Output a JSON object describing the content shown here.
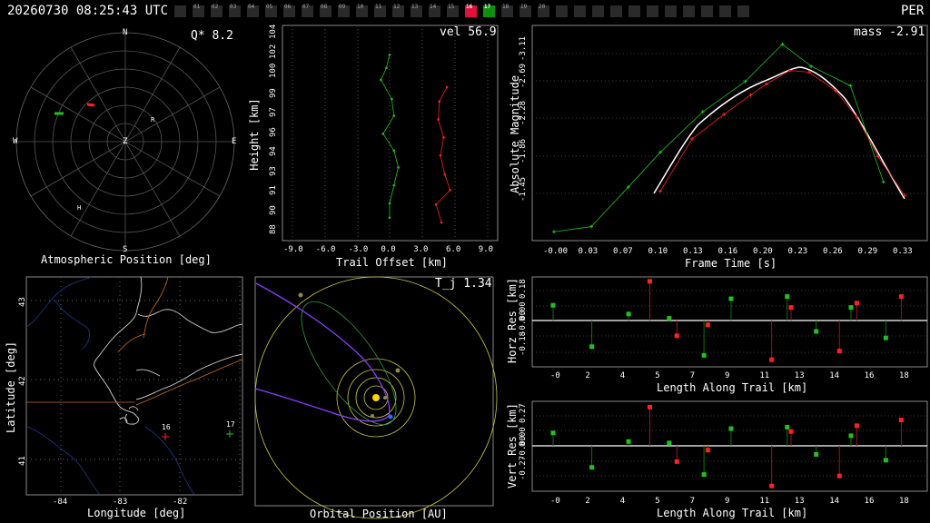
{
  "header": {
    "datetime": "20260730 08:25:43 UTC",
    "shower": "PER",
    "cameras": [
      {
        "id": "",
        "state": "off"
      },
      {
        "id": "01",
        "state": "off"
      },
      {
        "id": "02",
        "state": "off"
      },
      {
        "id": "03",
        "state": "off"
      },
      {
        "id": "04",
        "state": "off"
      },
      {
        "id": "05",
        "state": "off"
      },
      {
        "id": "06",
        "state": "off"
      },
      {
        "id": "07",
        "state": "off"
      },
      {
        "id": "08",
        "state": "off"
      },
      {
        "id": "09",
        "state": "off"
      },
      {
        "id": "10",
        "state": "off"
      },
      {
        "id": "11",
        "state": "off"
      },
      {
        "id": "12",
        "state": "off"
      },
      {
        "id": "13",
        "state": "off"
      },
      {
        "id": "14",
        "state": "off"
      },
      {
        "id": "15",
        "state": "off"
      },
      {
        "id": "16",
        "state": "red"
      },
      {
        "id": "17",
        "state": "green"
      },
      {
        "id": "18",
        "state": "off"
      },
      {
        "id": "19",
        "state": "off"
      },
      {
        "id": "20",
        "state": "off"
      },
      {
        "id": "",
        "state": "off"
      },
      {
        "id": "",
        "state": "off"
      },
      {
        "id": "",
        "state": "off"
      },
      {
        "id": "",
        "state": "off"
      },
      {
        "id": "",
        "state": "off"
      },
      {
        "id": "",
        "state": "off"
      },
      {
        "id": "",
        "state": "off"
      },
      {
        "id": "",
        "state": "off"
      },
      {
        "id": "",
        "state": "off"
      },
      {
        "id": "",
        "state": "off"
      },
      {
        "id": "",
        "state": "off"
      }
    ]
  },
  "colors": {
    "cam_red": "#e0123c",
    "cam_green": "#109010",
    "cam_off": "#2a2a2a",
    "series_red": "#ff2020",
    "series_green": "#20c020",
    "axis": "#ffffff"
  },
  "panels": {
    "atmo": {
      "caption": "Atmospheric Position [deg]",
      "metric": "Q*  8.2",
      "compass": {
        "N": "N",
        "S": "S",
        "E": "E",
        "W": "W",
        "Z": "Z"
      },
      "markers": {
        "radiant": "R",
        "h": "H"
      }
    },
    "height": {
      "metric": "vel 56.9",
      "xlabel": "Trail Offset [km]",
      "ylabel": "Height [km]",
      "xticks": [
        "-9.0",
        "-6.0",
        "-3.0",
        "0.0",
        "3.0",
        "6.0",
        "9.0"
      ],
      "yticks": [
        "88",
        "90",
        "91",
        "93",
        "94",
        "96",
        "97",
        "99",
        "100",
        "102",
        "104"
      ]
    },
    "magnitude": {
      "metric": "mass -2.91",
      "xlabel": "Frame Time [s]",
      "ylabel": "Absolute Magnitude",
      "xticks": [
        "-0.00",
        "0.03",
        "0.07",
        "0.10",
        "0.13",
        "0.16",
        "0.20",
        "0.23",
        "0.26",
        "0.29",
        "0.33"
      ],
      "yticks": [
        "-3.11",
        "-2.69",
        "-2.28",
        "-1.86",
        "-1.45"
      ]
    },
    "map": {
      "xlabel": "Longitude [deg]",
      "ylabel": "Latitude [deg]",
      "xticks": [
        "-84",
        "-83",
        "-82"
      ],
      "yticks": [
        "43",
        "42",
        "41"
      ],
      "stations": [
        {
          "label": "16"
        },
        {
          "label": "17"
        }
      ]
    },
    "orbit": {
      "caption": "Orbital Position [AU]",
      "metric": "T_j 1.34"
    },
    "horz": {
      "xlabel": "Length Along Trail [km]",
      "ylabel": "Horz Res [km]",
      "xticks": [
        "-0",
        "2",
        "4",
        "5",
        "7",
        "9",
        "11",
        "13",
        "14",
        "16",
        "18"
      ],
      "yticks": [
        "0.18",
        "0.00",
        "-0.00",
        "-0.18"
      ]
    },
    "vert": {
      "xlabel": "Length Along Trail [km]",
      "ylabel": "Vert Res [km]",
      "xticks": [
        "-0",
        "2",
        "4",
        "5",
        "7",
        "9",
        "11",
        "13",
        "14",
        "16",
        "18"
      ],
      "yticks": [
        "0.27",
        "0.00",
        "-0.00",
        "-0.27"
      ]
    }
  },
  "chart_data": [
    {
      "type": "line",
      "name": "height",
      "xlim": [
        -10.5,
        10.5
      ],
      "series": [
        {
          "color": "green",
          "points": [
            [
              0,
              102.3
            ],
            [
              -0.3,
              101.2
            ],
            [
              -0.8,
              100.2
            ],
            [
              0.2,
              98.6
            ],
            [
              0.4,
              97.2
            ],
            [
              -0.6,
              95.7
            ],
            [
              0.4,
              94.3
            ],
            [
              0.8,
              92.9
            ],
            [
              0.4,
              91.4
            ],
            [
              0.0,
              89.9
            ],
            [
              0.0,
              88.7
            ]
          ]
        },
        {
          "color": "red",
          "points": [
            [
              5.3,
              99.6
            ],
            [
              4.6,
              98.4
            ],
            [
              4.5,
              96.9
            ],
            [
              5.0,
              95.4
            ],
            [
              4.7,
              93.9
            ],
            [
              5.1,
              92.3
            ],
            [
              5.6,
              91.0
            ],
            [
              4.3,
              89.8
            ],
            [
              4.8,
              88.3
            ]
          ]
        }
      ]
    },
    {
      "type": "line",
      "name": "magnitude",
      "xlim": [
        -0.01,
        0.34
      ],
      "series": [
        {
          "color": "green",
          "points": [
            [
              0.0,
              -1.0
            ],
            [
              0.035,
              -1.06
            ],
            [
              0.07,
              -1.53
            ],
            [
              0.1,
              -1.94
            ],
            [
              0.14,
              -2.42
            ],
            [
              0.18,
              -2.78
            ],
            [
              0.215,
              -3.22
            ],
            [
              0.242,
              -2.96
            ],
            [
              0.279,
              -2.73
            ],
            [
              0.31,
              -1.59
            ]
          ]
        },
        {
          "color": "red",
          "points": [
            [
              0.1,
              -1.48
            ],
            [
              0.13,
              -2.1
            ],
            [
              0.16,
              -2.39
            ],
            [
              0.185,
              -2.62
            ],
            [
              0.2,
              -2.75
            ],
            [
              0.222,
              -2.91
            ],
            [
              0.24,
              -2.89
            ],
            [
              0.265,
              -2.67
            ],
            [
              0.285,
              -2.36
            ],
            [
              0.305,
              -1.89
            ],
            [
              0.33,
              -1.43
            ]
          ]
        }
      ]
    },
    {
      "type": "scatter",
      "name": "horz_res",
      "series": [
        {
          "color": "green",
          "points": [
            [
              0.0,
              0.07
            ],
            [
              2.0,
              -0.12
            ],
            [
              3.9,
              0.03
            ],
            [
              6.0,
              0.01
            ],
            [
              7.8,
              -0.16
            ],
            [
              9.2,
              0.1
            ],
            [
              12.1,
              0.11
            ],
            [
              13.6,
              -0.05
            ],
            [
              15.4,
              0.06
            ],
            [
              17.2,
              -0.08
            ]
          ]
        },
        {
          "color": "red",
          "points": [
            [
              5.0,
              0.18
            ],
            [
              6.4,
              -0.07
            ],
            [
              8.0,
              -0.02
            ],
            [
              11.3,
              -0.18
            ],
            [
              12.3,
              0.06
            ],
            [
              14.8,
              -0.14
            ],
            [
              15.7,
              0.08
            ],
            [
              18.0,
              0.11
            ]
          ]
        }
      ]
    },
    {
      "type": "scatter",
      "name": "vert_res",
      "series": [
        {
          "color": "green",
          "points": [
            [
              0.0,
              0.09
            ],
            [
              2.0,
              -0.15
            ],
            [
              3.9,
              0.03
            ],
            [
              6.0,
              0.02
            ],
            [
              7.8,
              -0.2
            ],
            [
              9.2,
              0.12
            ],
            [
              12.1,
              0.13
            ],
            [
              13.6,
              -0.06
            ],
            [
              15.4,
              0.07
            ],
            [
              17.2,
              -0.1
            ]
          ]
        },
        {
          "color": "red",
          "points": [
            [
              5.0,
              0.27
            ],
            [
              6.4,
              -0.11
            ],
            [
              8.0,
              -0.03
            ],
            [
              11.3,
              -0.28
            ],
            [
              12.3,
              0.1
            ],
            [
              14.8,
              -0.21
            ],
            [
              15.7,
              0.14
            ],
            [
              18.0,
              0.18
            ]
          ]
        }
      ]
    }
  ]
}
